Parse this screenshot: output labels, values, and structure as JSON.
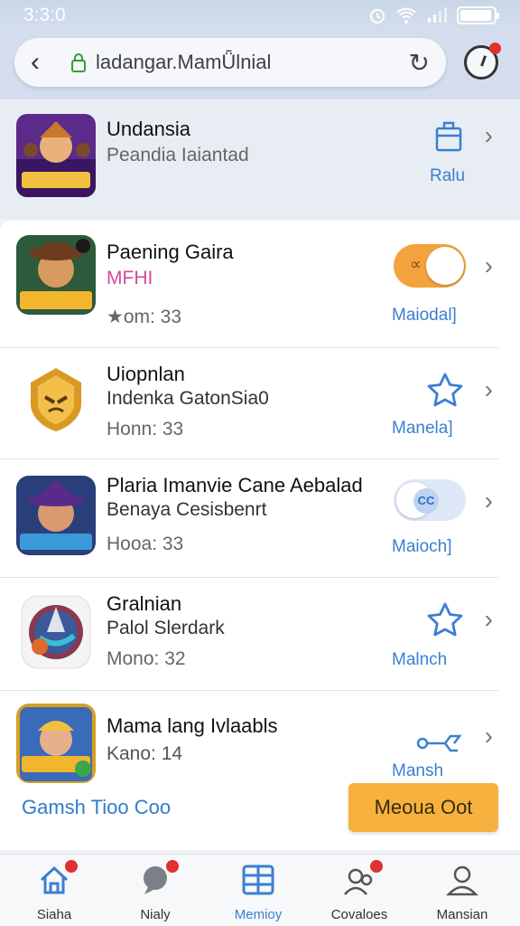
{
  "status_bar": {
    "time": "3:3:0"
  },
  "url_bar": {
    "url": "ladangar.MamǕlnial"
  },
  "top_item": {
    "title": "Undansia",
    "subtitle": "Peandia Iaiantad",
    "action_label": "Ralu"
  },
  "items": [
    {
      "title": "Paening Gaira",
      "tag": "MFHI",
      "meta": "★om: 33",
      "action_label": "Maiodal]",
      "control": "toggle-on"
    },
    {
      "title": "Uiopnlan",
      "subtitle": "Indenka GatonSia0",
      "meta": "Honn: 33",
      "action_label": "Manela]",
      "control": "star"
    },
    {
      "title": "Plaria Imanvie Cane Aebalad",
      "subtitle": "Benaya Cesisbenrt",
      "meta": "Hooa: 33",
      "action_label": "Maioch]",
      "control": "toggle-off"
    },
    {
      "title": "Gralnian",
      "subtitle": "Palol Slerdark",
      "meta": "Mono: 32",
      "action_label": "Malnch",
      "control": "star"
    },
    {
      "title": "Mama lang Ivlaabls",
      "subtitle": "Kano: 14",
      "action_label": "Mansh",
      "control": "link"
    }
  ],
  "footer": {
    "link_label": "Gamsh Tioo Coo",
    "button_label": "Meoua Oot"
  },
  "tabs": [
    {
      "label": "Siaha",
      "icon": "home-icon",
      "badge": true
    },
    {
      "label": "Nialy",
      "icon": "chat-icon",
      "badge": true
    },
    {
      "label": "Memioy",
      "icon": "grid-icon",
      "badge": false
    },
    {
      "label": "Covaloes",
      "icon": "people-icon",
      "badge": true
    },
    {
      "label": "Mansian",
      "icon": "profile-icon",
      "badge": false
    }
  ],
  "colors": {
    "accent": "#3b7fd0",
    "orange": "#f3a23e",
    "badge": "#e03030"
  }
}
